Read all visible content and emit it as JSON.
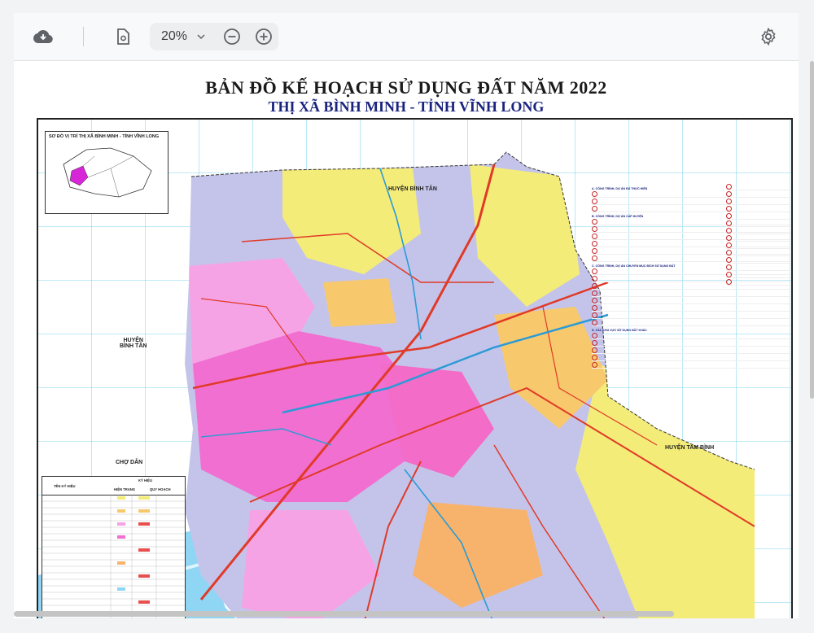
{
  "toolbar": {
    "zoom_value": "20%",
    "icons": [
      "cloud-download-icon",
      "document-settings-icon",
      "chevron-down-icon",
      "zoom-out-icon",
      "zoom-in-icon",
      "gear-icon"
    ]
  },
  "map": {
    "title": "BẢN ĐỒ KẾ HOẠCH SỬ DỤNG ĐẤT NĂM 2022",
    "subtitle": "THỊ XÃ BÌNH MINH - TỈNH VĨNH LONG",
    "inset_title": "SƠ ĐỒ VỊ TRÍ THỊ XÃ BÌNH MINH - TỈNH VĨNH LONG",
    "places": {
      "north": "HUYỆN BÌNH TÂN",
      "west_line1": "HUYỆN",
      "west_line2": "BÌNH TÂN",
      "east": "HUYỆN TAM BÌNH",
      "southwest": "CHỢ DẪN"
    },
    "legend": {
      "col_name": "TÊN KÝ HIỆU",
      "col_symbol": "KÝ HIỆU",
      "col_current": "HIỆN TRẠNG",
      "col_plan": "QUY HOẠCH"
    },
    "notes_heading_a": "A. CÔNG TRÌNH, DỰ ÁN ĐÃ THỰC HIỆN",
    "notes_heading_b": "B. CÔNG TRÌNH, DỰ ÁN CẤP HUYỆN",
    "notes_heading_c": "C. CÔNG TRÌNH, DỰ ÁN CHUYỂN MỤC ĐÍCH SỬ DỤNG ĐẤT",
    "notes_heading_d": "D. CÁC KHU VỰC SỬ DỤNG ĐẤT KHÁC"
  },
  "colors": {
    "urban": "#f06fd0",
    "residential": "#f6a3e6",
    "agri": "#f4ec78",
    "orchard": "#f7c96c",
    "water": "#8fd6f4",
    "road": "#e03a28",
    "canal": "#2b9ad6",
    "land_base": "#c4c4ea"
  }
}
